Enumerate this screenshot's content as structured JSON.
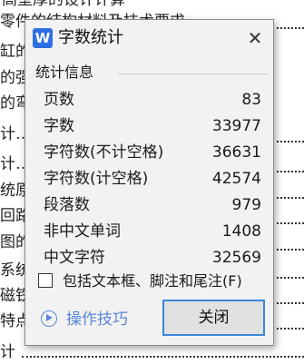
{
  "document": {
    "lines": [
      "高壁厚的设计计算",
      "零件的结构材料及技术要求",
      "缸的",
      "的强",
      "的弯",
      "计……",
      "计…",
      "统原",
      "回路",
      "图的",
      "系统",
      "磁铁",
      "特点",
      "计"
    ]
  },
  "dialog": {
    "app_icon_letter": "W",
    "title": "字数统计",
    "close_symbol": "✕",
    "section_title": "统计信息",
    "stats": [
      {
        "label": "页数",
        "value": "83"
      },
      {
        "label": "字数",
        "value": "33977"
      },
      {
        "label": "字符数(不计空格)",
        "value": "36631"
      },
      {
        "label": "字符数(计空格)",
        "value": "42574"
      },
      {
        "label": "段落数",
        "value": "979"
      },
      {
        "label": "非中文单词",
        "value": "1408"
      },
      {
        "label": "中文字符",
        "value": "32569"
      }
    ],
    "checkbox_label": "包括文本框、脚注和尾注(F)",
    "tips_label": "操作技巧",
    "close_button": "关闭"
  }
}
